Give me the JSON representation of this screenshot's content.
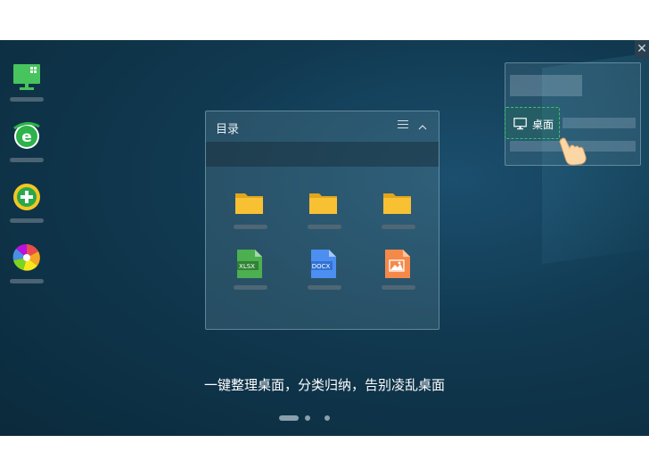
{
  "window": {
    "close_symbol": "✕"
  },
  "sidebar": {
    "icons": [
      {
        "name": "monitor-grid-app-icon"
      },
      {
        "name": "ie-browser-icon"
      },
      {
        "name": "plus-app-icon"
      },
      {
        "name": "pinwheel-app-icon"
      }
    ]
  },
  "panel": {
    "title": "目录",
    "files": [
      {
        "type": "folder",
        "label": ""
      },
      {
        "type": "folder",
        "label": ""
      },
      {
        "type": "folder",
        "label": ""
      },
      {
        "type": "xlsx",
        "label": "XLSX"
      },
      {
        "type": "docx",
        "label": "DOCX"
      },
      {
        "type": "image",
        "label": ""
      }
    ]
  },
  "preview": {
    "desktop_label": "桌面"
  },
  "caption": "一键整理桌面，分类归纳，告别凌乱桌面",
  "colors": {
    "accent_green": "#37c46f",
    "folder": "#f7c133",
    "xlsx": "#4caf50",
    "docx": "#4c8ff0",
    "image": "#f5894a"
  }
}
